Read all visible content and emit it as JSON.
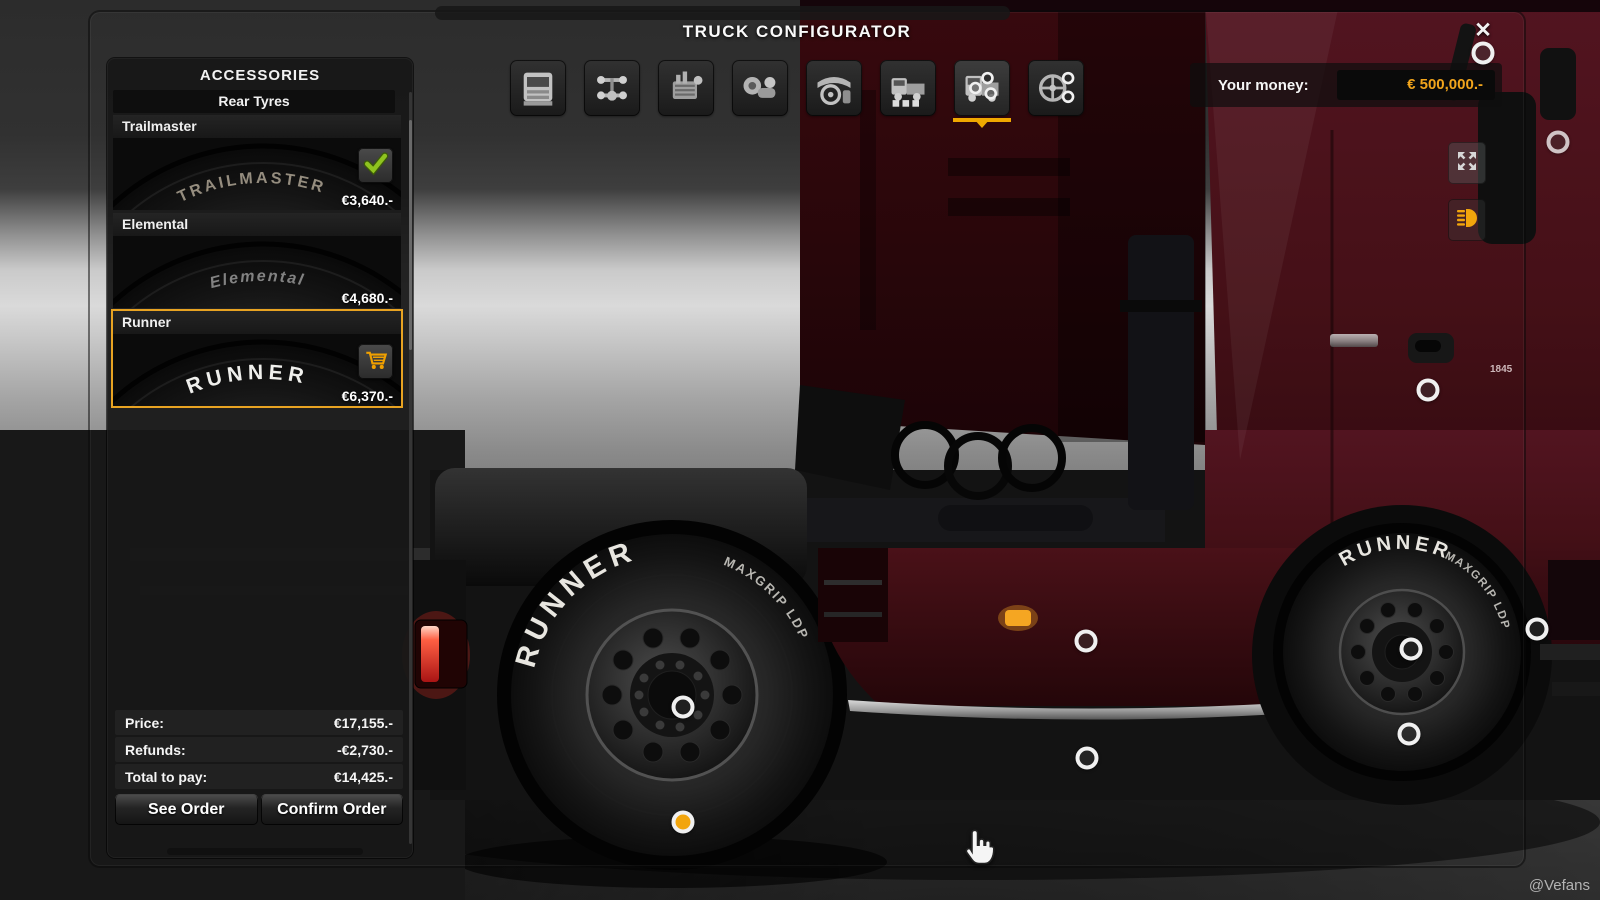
{
  "window": {
    "title": "TRUCK CONFIGURATOR",
    "close_glyph": "✕",
    "watermark": "@Vefans"
  },
  "money": {
    "label": "Your money:",
    "value": "€ 500,000.-"
  },
  "categories": {
    "selected_index": 6,
    "items": [
      {
        "icon": "cabin-icon"
      },
      {
        "icon": "chassis-icon"
      },
      {
        "icon": "engine-icon"
      },
      {
        "icon": "transmission-icon"
      },
      {
        "icon": "interior-icon"
      },
      {
        "icon": "exterior-icon"
      },
      {
        "icon": "exterior-accessories-icon"
      },
      {
        "icon": "wheel-accessories-icon"
      }
    ]
  },
  "accessories": {
    "title": "ACCESSORIES",
    "subtitle": "Rear Tyres",
    "items": [
      {
        "name": "Trailmaster",
        "tyre_text": "TRAILMASTER",
        "price": "€3,640.-",
        "state": "installed",
        "state_icon": "check-icon"
      },
      {
        "name": "Elemental",
        "tyre_text": "Elemental",
        "price": "€4,680.-",
        "state": "available",
        "state_icon": ""
      },
      {
        "name": "Runner",
        "tyre_text": "RUNNER",
        "price": "€6,370.-",
        "state": "in_cart",
        "state_icon": "cart-icon",
        "selected": true
      }
    ],
    "summary": [
      {
        "label": "Price:",
        "value": "€17,155.-"
      },
      {
        "label": "Refunds:",
        "value": "-€2,730.-"
      },
      {
        "label": "Total to pay:",
        "value": "€14,425.-"
      }
    ],
    "buttons": [
      {
        "label": "See Order"
      },
      {
        "label": "Confirm Order"
      }
    ]
  },
  "viewport": {
    "tyre_brand": "RUNNER",
    "tyre_spec": "MAXGRIP LDP",
    "model_badge": "1845",
    "side_buttons": [
      {
        "icon": "fullscreen-icon"
      },
      {
        "icon": "headlight-icon"
      }
    ]
  },
  "colors": {
    "accent_orange": "#f0a800",
    "money_text": "#f2a51c",
    "check_green": "#8fc31f",
    "selection_border": "#e8a322",
    "cab_red": "#451017"
  }
}
